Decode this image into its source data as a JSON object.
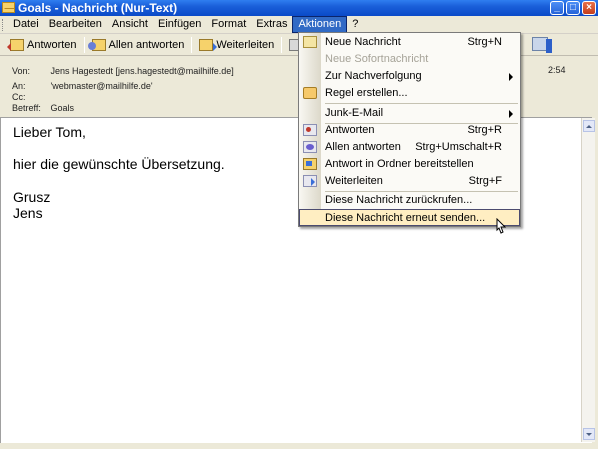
{
  "window": {
    "title": "Goals - Nachricht (Nur-Text)",
    "controls": {
      "minimize": "_",
      "maximize": "□",
      "close": "×"
    }
  },
  "menubar": {
    "items": [
      "Datei",
      "Bearbeiten",
      "Ansicht",
      "Einfügen",
      "Format",
      "Extras",
      "Aktionen",
      "?"
    ],
    "active": "Aktionen"
  },
  "toolbar": {
    "reply_label": "Antworten",
    "replyall_label": "Allen antworten",
    "forward_label": "Weiterleiten"
  },
  "header": {
    "from_label": "Von:",
    "from_value": "Jens Hagestedt [jens.hagestedt@mailhilfe.de]",
    "to_label": "An:",
    "to_value": "'webmaster@mailhilfe.de'",
    "cc_label": "Cc:",
    "cc_value": "",
    "subject_label": "Betreff:",
    "subject_value": "Goals",
    "sent_partial": "2:54"
  },
  "body": {
    "lines": [
      "Lieber Tom,",
      "hier die gewünschte Übersetzung.",
      "Grusz",
      "Jens"
    ]
  },
  "actions_menu": {
    "items": [
      {
        "label": "Neue Nachricht",
        "shortcut": "Strg+N",
        "icon": "new-message-icon"
      },
      {
        "label": "Neue Sofortnachricht",
        "shortcut": "",
        "icon": "",
        "disabled": true
      },
      {
        "label": "Zur Nachverfolgung",
        "shortcut": "",
        "icon": "",
        "submenu": true
      },
      {
        "label": "Regel erstellen...",
        "shortcut": "",
        "icon": "rule-icon"
      },
      {
        "label": "Junk-E-Mail",
        "shortcut": "",
        "icon": "",
        "submenu": true
      },
      {
        "label": "Antworten",
        "shortcut": "Strg+R",
        "icon": "reply-icon"
      },
      {
        "label": "Allen antworten",
        "shortcut": "Strg+Umschalt+R",
        "icon": "reply-all-icon"
      },
      {
        "label": "Antwort in Ordner bereitstellen",
        "shortcut": "",
        "icon": "post-reply-folder-icon"
      },
      {
        "label": "Weiterleiten",
        "shortcut": "Strg+F",
        "icon": "forward-icon"
      },
      {
        "label": "Diese Nachricht zurückrufen...",
        "shortcut": "",
        "icon": ""
      },
      {
        "label": "Diese Nachricht erneut senden...",
        "shortcut": "",
        "icon": "",
        "selected": true
      }
    ]
  }
}
